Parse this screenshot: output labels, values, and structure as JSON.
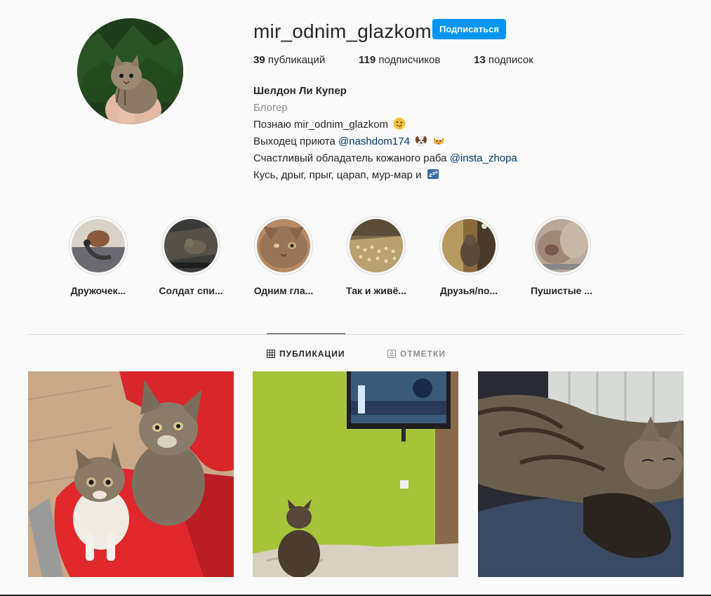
{
  "profile": {
    "username": "mir_odnim_glazkom",
    "follow_label": "Подписаться",
    "stats": {
      "posts_count": "39",
      "posts_label": "публикаций",
      "followers_count": "119",
      "followers_label": "подписчиков",
      "following_count": "13",
      "following_label": "подписок"
    },
    "bio": {
      "name": "Шелдон Ли Купер",
      "category": "Блогер",
      "line1": "Познаю mir_odnim_glazkom",
      "line2_text": "Выходец приюта",
      "line2_mention": "@nashdom174",
      "line3_text": "Счастливый обладатель кожаного раба",
      "line3_mention": "@insta_zhopa",
      "line4": "Кусь, дрыг, прыг, царап, мур-мар и"
    }
  },
  "highlights": [
    {
      "label": "Дружочек..."
    },
    {
      "label": "Солдат спи..."
    },
    {
      "label": "Одним гла..."
    },
    {
      "label": "Так и живё..."
    },
    {
      "label": "Друзья/по..."
    },
    {
      "label": "Пушистые ..."
    }
  ],
  "tabs": {
    "posts_label": "ПУБЛИКАЦИИ",
    "tagged_label": "ОТМЕТКИ"
  },
  "colors": {
    "accent": "#0095f6",
    "mention": "#00376b",
    "muted": "#8e8e8e"
  }
}
